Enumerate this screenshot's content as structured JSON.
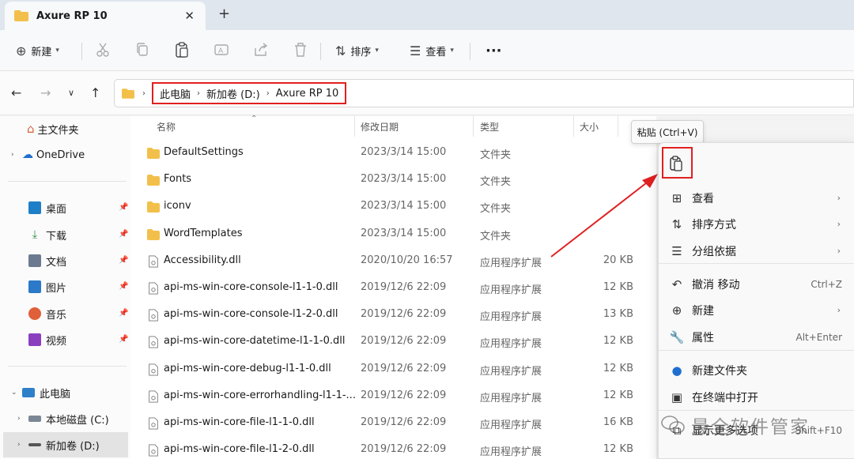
{
  "tab": {
    "title": "Axure RP 10",
    "close": "✕",
    "new_tab": "+"
  },
  "commandbar": {
    "new_label": "新建",
    "sort_label": "排序",
    "view_label": "查看",
    "more": "···"
  },
  "address": {
    "crumbs": [
      "此电脑",
      "新加卷 (D:)",
      "Axure RP 10"
    ]
  },
  "sidebar": {
    "home": "主文件夹",
    "onedrive": "OneDrive",
    "quick": [
      {
        "label": "桌面",
        "color": "#1e7fc8"
      },
      {
        "label": "下载",
        "color": "#2f8d44"
      },
      {
        "label": "文档",
        "color": "#6b7a8f"
      },
      {
        "label": "图片",
        "color": "#2b79c9"
      },
      {
        "label": "音乐",
        "color": "#e0603a"
      },
      {
        "label": "视频",
        "color": "#8a3fbf"
      }
    ],
    "thispc": "此电脑",
    "drives": [
      "本地磁盘 (C:)",
      "新加卷 (D:)"
    ]
  },
  "filelist": {
    "headers": {
      "name": "名称",
      "date": "修改日期",
      "type": "类型",
      "size": "大小"
    },
    "rows": [
      {
        "name": "DefaultSettings",
        "date": "2023/3/14 15:00",
        "type": "文件夹",
        "size": "",
        "kind": "folder"
      },
      {
        "name": "Fonts",
        "date": "2023/3/14 15:00",
        "type": "文件夹",
        "size": "",
        "kind": "folder"
      },
      {
        "name": "iconv",
        "date": "2023/3/14 15:00",
        "type": "文件夹",
        "size": "",
        "kind": "folder"
      },
      {
        "name": "WordTemplates",
        "date": "2023/3/14 15:00",
        "type": "文件夹",
        "size": "",
        "kind": "folder"
      },
      {
        "name": "Accessibility.dll",
        "date": "2020/10/20 16:57",
        "type": "应用程序扩展",
        "size": "20 KB",
        "kind": "dll"
      },
      {
        "name": "api-ms-win-core-console-l1-1-0.dll",
        "date": "2019/12/6 22:09",
        "type": "应用程序扩展",
        "size": "12 KB",
        "kind": "dll"
      },
      {
        "name": "api-ms-win-core-console-l1-2-0.dll",
        "date": "2019/12/6 22:09",
        "type": "应用程序扩展",
        "size": "13 KB",
        "kind": "dll"
      },
      {
        "name": "api-ms-win-core-datetime-l1-1-0.dll",
        "date": "2019/12/6 22:09",
        "type": "应用程序扩展",
        "size": "12 KB",
        "kind": "dll"
      },
      {
        "name": "api-ms-win-core-debug-l1-1-0.dll",
        "date": "2019/12/6 22:09",
        "type": "应用程序扩展",
        "size": "12 KB",
        "kind": "dll"
      },
      {
        "name": "api-ms-win-core-errorhandling-l1-1-...",
        "date": "2019/12/6 22:09",
        "type": "应用程序扩展",
        "size": "12 KB",
        "kind": "dll"
      },
      {
        "name": "api-ms-win-core-file-l1-1-0.dll",
        "date": "2019/12/6 22:09",
        "type": "应用程序扩展",
        "size": "16 KB",
        "kind": "dll"
      },
      {
        "name": "api-ms-win-core-file-l1-2-0.dll",
        "date": "2019/12/6 22:09",
        "type": "应用程序扩展",
        "size": "12 KB",
        "kind": "dll"
      }
    ]
  },
  "context_menu": {
    "tooltip": "粘贴 (Ctrl+V)",
    "items": [
      {
        "label": "查看",
        "shortcut": "",
        "submenu": true,
        "icon": "grid-icon"
      },
      {
        "label": "排序方式",
        "shortcut": "",
        "submenu": true,
        "icon": "sort-icon"
      },
      {
        "label": "分组依据",
        "shortcut": "",
        "submenu": true,
        "icon": "group-icon"
      },
      {
        "label": "撤消 移动",
        "shortcut": "Ctrl+Z",
        "submenu": false,
        "icon": "undo-icon"
      },
      {
        "label": "新建",
        "shortcut": "",
        "submenu": true,
        "icon": "new-icon"
      },
      {
        "label": "属性",
        "shortcut": "Alt+Enter",
        "submenu": false,
        "icon": "wrench-icon"
      },
      {
        "label": "新建文件夹",
        "shortcut": "",
        "submenu": false,
        "icon": "new-folder-icon"
      },
      {
        "label": "在终端中打开",
        "shortcut": "",
        "submenu": false,
        "icon": "terminal-icon"
      },
      {
        "label": "显示更多选项",
        "shortcut": "Shift+F10",
        "submenu": false,
        "icon": "more-options-icon"
      }
    ]
  },
  "watermark": {
    "text": "最全软件管家"
  },
  "colors": {
    "highlight": "#e02020",
    "folder": "#f2c04a",
    "accent": "#1f6fd0"
  }
}
